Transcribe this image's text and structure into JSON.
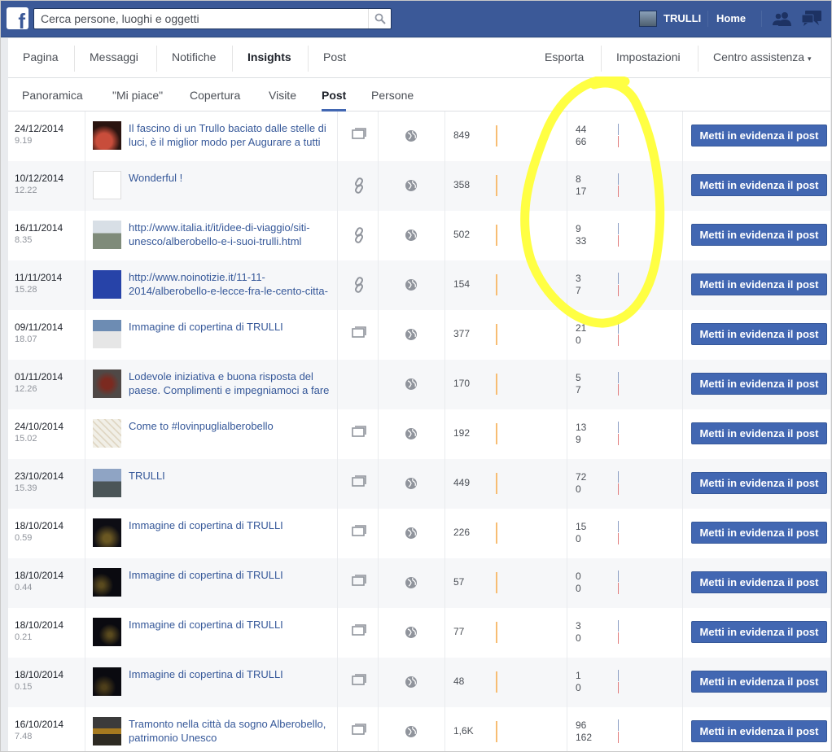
{
  "topbar": {
    "logo": "f",
    "search_placeholder": "Cerca persone, luoghi e oggetti",
    "page_name": "TRULLI",
    "home": "Home"
  },
  "pagenav": {
    "items": [
      "Pagina",
      "Messaggi",
      "Notifiche",
      "Insights",
      "Post"
    ],
    "active": "Insights",
    "right": {
      "export": "Esporta",
      "settings": "Impostazioni",
      "help": "Centro assistenza",
      "caret": "▾"
    }
  },
  "subnav": {
    "tabs": [
      "Panoramica",
      "\"Mi piace\"",
      "Copertura",
      "Visite",
      "Post",
      "Persone"
    ],
    "active": "Post"
  },
  "boost_label": "Metti in evidenza il post",
  "colors": {
    "accent": "#3b5998",
    "button": "#4267b2",
    "reach_bar": "#f7bd73",
    "highlight": "#ffff33"
  },
  "posts": [
    {
      "date": "24/12/2014",
      "time": "9.19",
      "title": "Il fascino di un Trullo baciato dalle stelle di luci, è il miglior modo per Augurare a tutti",
      "type": "photo-icon",
      "reach": "849",
      "eng_a": "44",
      "eng_b": "66"
    },
    {
      "date": "10/12/2014",
      "time": "12.22",
      "title": "Wonderful !",
      "type": "link-icon",
      "reach": "358",
      "eng_a": "8",
      "eng_b": "17"
    },
    {
      "date": "16/11/2014",
      "time": "8.35",
      "title": "http://www.italia.it/it/idee-di-viaggio/siti-unesco/alberobello-e-i-suoi-trulli.html",
      "type": "link-icon",
      "reach": "502",
      "eng_a": "9",
      "eng_b": "33"
    },
    {
      "date": "11/11/2014",
      "time": "15.28",
      "title": "http://www.noinotizie.it/11-11-2014/alberobello-e-lecce-fra-le-cento-citta-",
      "type": "link-icon",
      "reach": "154",
      "eng_a": "3",
      "eng_b": "7"
    },
    {
      "date": "09/11/2014",
      "time": "18.07",
      "title": "Immagine di copertina di TRULLI",
      "type": "photo-icon",
      "reach": "377",
      "eng_a": "21",
      "eng_b": "0"
    },
    {
      "date": "01/11/2014",
      "time": "12.26",
      "title": "Lodevole iniziativa e buona risposta del paese. Complimenti e impegniamoci a fare",
      "type": "",
      "reach": "170",
      "eng_a": "5",
      "eng_b": "7"
    },
    {
      "date": "24/10/2014",
      "time": "15.02",
      "title": "Come to #lovinpuglialberobello",
      "type": "photo-icon",
      "reach": "192",
      "eng_a": "13",
      "eng_b": "9"
    },
    {
      "date": "23/10/2014",
      "time": "15.39",
      "title": "TRULLI",
      "type": "photo-icon",
      "reach": "449",
      "eng_a": "72",
      "eng_b": "0"
    },
    {
      "date": "18/10/2014",
      "time": "0.59",
      "title": "Immagine di copertina di TRULLI",
      "type": "photo-icon",
      "reach": "226",
      "eng_a": "15",
      "eng_b": "0"
    },
    {
      "date": "18/10/2014",
      "time": "0.44",
      "title": "Immagine di copertina di TRULLI",
      "type": "photo-icon",
      "reach": "57",
      "eng_a": "0",
      "eng_b": "0"
    },
    {
      "date": "18/10/2014",
      "time": "0.21",
      "title": "Immagine di copertina di TRULLI",
      "type": "photo-icon",
      "reach": "77",
      "eng_a": "3",
      "eng_b": "0"
    },
    {
      "date": "18/10/2014",
      "time": "0.15",
      "title": "Immagine di copertina di TRULLI",
      "type": "photo-icon",
      "reach": "48",
      "eng_a": "1",
      "eng_b": "0"
    },
    {
      "date": "16/10/2014",
      "time": "7.48",
      "title": "Tramonto nella città da sogno Alberobello, patrimonio Unesco",
      "type": "photo-icon",
      "reach": "1,6K",
      "eng_a": "96",
      "eng_b": "162"
    }
  ]
}
